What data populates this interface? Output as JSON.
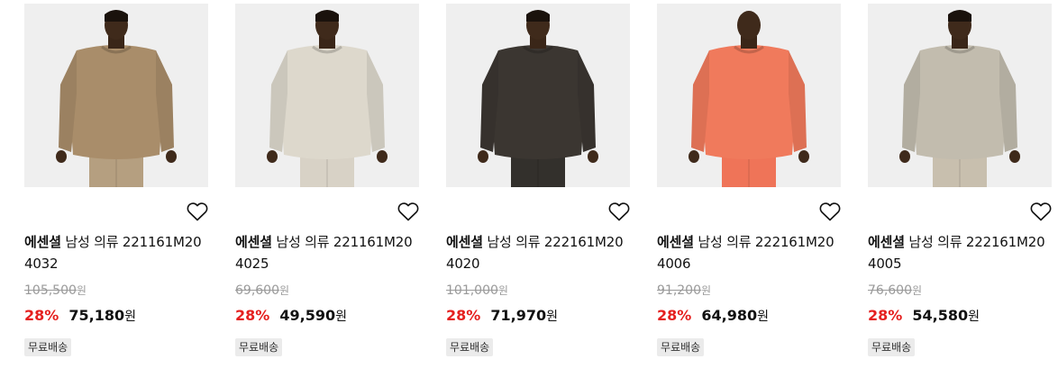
{
  "products": [
    {
      "brand": "에센셜",
      "name": "남성 의류 221161M20",
      "code": "4032",
      "original_price": "105,500",
      "discount": "28%",
      "price": "75,180",
      "currency": "원",
      "badge": "무료배송",
      "sweater_color": "#a98d6a",
      "pants_color": "#b59f80"
    },
    {
      "brand": "에센셜",
      "name": "남성 의류 221161M20",
      "code": "4025",
      "original_price": "69,600",
      "discount": "28%",
      "price": "49,590",
      "currency": "원",
      "badge": "무료배송",
      "sweater_color": "#ddd8cc",
      "pants_color": "#d8d2c6"
    },
    {
      "brand": "에센셜",
      "name": "남성 의류 222161M20",
      "code": "4020",
      "original_price": "101,000",
      "discount": "28%",
      "price": "71,970",
      "currency": "원",
      "badge": "무료배송",
      "sweater_color": "#3b3631",
      "pants_color": "#33302c"
    },
    {
      "brand": "에센셜",
      "name": "남성 의류 222161M20",
      "code": "4006",
      "original_price": "91,200",
      "discount": "28%",
      "price": "64,980",
      "currency": "원",
      "badge": "무료배송",
      "sweater_color": "#f07a5c",
      "pants_color": "#ef7458"
    },
    {
      "brand": "에센셜",
      "name": "남성 의류 222161M20",
      "code": "4005",
      "original_price": "76,600",
      "discount": "28%",
      "price": "54,580",
      "currency": "원",
      "badge": "무료배송",
      "sweater_color": "#c2bcae",
      "pants_color": "#c8bfae"
    }
  ]
}
